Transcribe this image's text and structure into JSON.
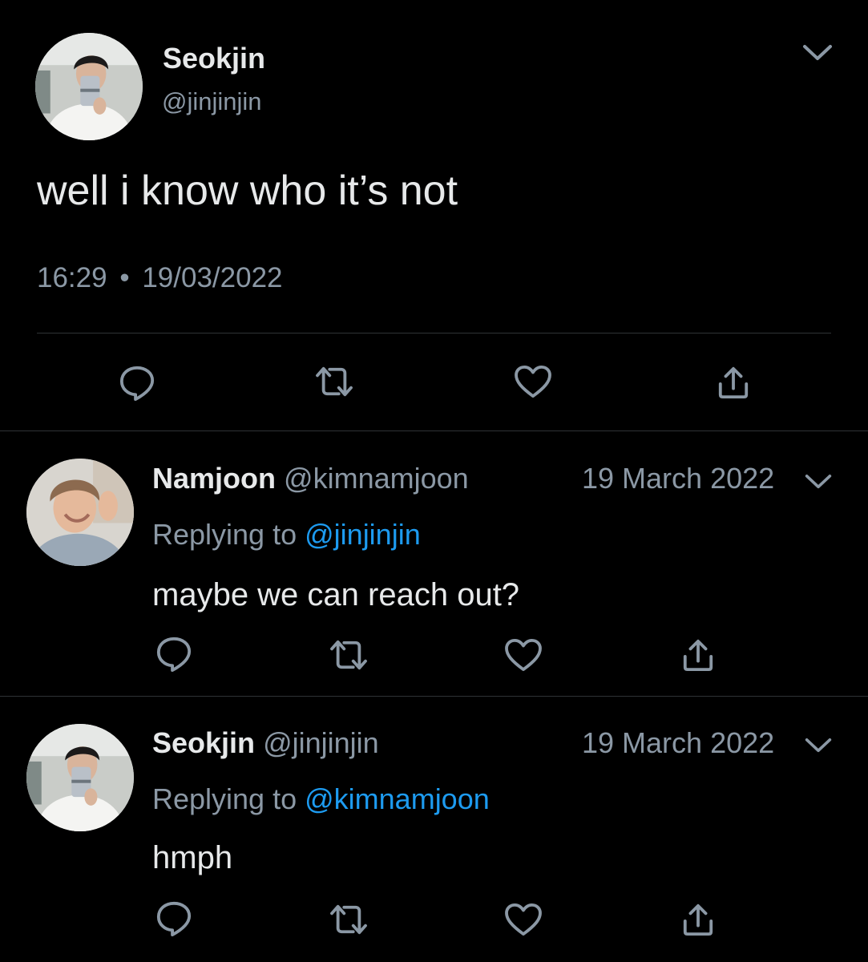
{
  "main_tweet": {
    "display_name": "Seokjin",
    "handle": "@jinjinjin",
    "text": "well i know who it’s not",
    "time": "16:29",
    "separator": "•",
    "date": "19/03/2022",
    "avatar_icon": "profile-photo-seokjin",
    "menu_icon": "chevron-down-icon"
  },
  "replies": [
    {
      "display_name": "Namjoon",
      "handle": "@kimnamjoon",
      "date": "19 March 2022",
      "replying_prefix": "Replying to",
      "replying_to": "@jinjinjin",
      "text": "maybe we can reach out?",
      "avatar_icon": "profile-photo-namjoon"
    },
    {
      "display_name": "Seokjin",
      "handle": "@jinjinjin",
      "date": "19 March 2022",
      "replying_prefix": "Replying to",
      "replying_to": "@kimnamjoon",
      "text": "hmph",
      "avatar_icon": "profile-photo-seokjin"
    }
  ],
  "actions": [
    "reply-icon",
    "retweet-icon",
    "like-icon",
    "share-icon"
  ],
  "colors": {
    "background": "#000000",
    "text": "#e7e9ea",
    "muted": "#8b98a5",
    "link": "#1d9bf0",
    "divider": "#2f3336"
  }
}
